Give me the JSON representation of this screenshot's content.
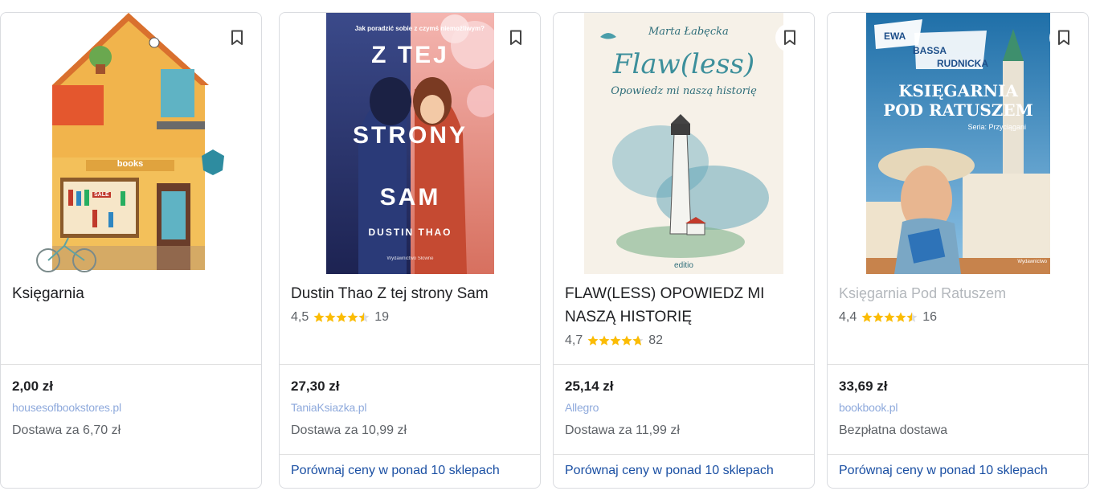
{
  "products": [
    {
      "title": "Dustin Thao Z tej strony Sam",
      "rating": "4,5",
      "reviews": "19",
      "price": "27,30 zł",
      "store": "TaniaKsiazka.pl",
      "shipping": "Dostawa za 10,99 zł",
      "compare": "Porównaj ceny w ponad 10 sklepach",
      "cover": {
        "top_text": "Jak poradzić sobie z czymś niemożliwym?",
        "title_lines": [
          "Z TEJ",
          "STRONY",
          "SAM"
        ],
        "author": "DUSTIN THAO",
        "publisher": "Wydawnictwo Słowne"
      }
    },
    {
      "title": "FLAW(LESS) OPOWIEDZ MI NASZĄ HISTORIĘ",
      "rating": "4,7",
      "reviews": "82",
      "price": "25,14 zł",
      "store": "Allegro",
      "shipping": "Dostawa za 11,99 zł",
      "compare": "Porównaj ceny w ponad 10 sklepach",
      "cover": {
        "author": "Marta Łabęcka",
        "title": "Flaw(less)",
        "subtitle": "Opowiedz mi naszą historię",
        "publisher": "editio"
      }
    },
    {
      "title": "Księgarnia Pod Ratuszem",
      "rating": "4,4",
      "reviews": "16",
      "price": "33,69 zł",
      "store": "bookbook.pl",
      "shipping": "Bezpłatna dostawa",
      "compare": "Porównaj ceny w ponad 10 sklepach",
      "cover": {
        "author_lines": [
          "EWA",
          "BASSA",
          "RUDNICKA"
        ],
        "title_lines": [
          "KSIĘGARNIA",
          "POD RATUSZEM"
        ],
        "series": "Seria: Przyciągani",
        "publisher": "Wydawnictwo"
      }
    },
    {
      "title": "Księgarnia",
      "rating": "",
      "reviews": "",
      "price": "2,00 zł",
      "store": "housesofbookstores.pl",
      "shipping": "Dostawa za 6,70 zł",
      "compare": "",
      "cover": {
        "shop_sign": "books",
        "sale_tag": "SALE"
      }
    }
  ],
  "icons": {
    "bookmark": "bookmark-icon",
    "star": "star-icon"
  },
  "colors": {
    "star": "#fbbc04",
    "link": "#1a4fa3",
    "muted": "#5f6368",
    "border": "#dadce0"
  }
}
